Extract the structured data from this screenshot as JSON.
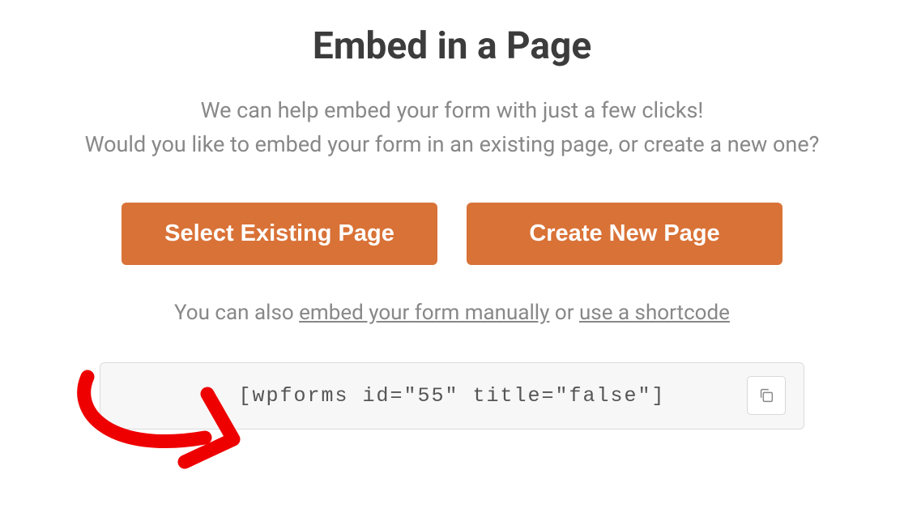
{
  "title": "Embed in a Page",
  "subtitle_line1": "We can help embed your form with just a few clicks!",
  "subtitle_line2": "Would you like to embed your form in an existing page, or create a new one?",
  "buttons": {
    "existing": "Select Existing Page",
    "new": "Create New Page"
  },
  "alt": {
    "prefix": "You can also ",
    "link1": "embed your form manually",
    "middle": " or ",
    "link2": "use a shortcode"
  },
  "shortcode": "[wpforms id=\"55\" title=\"false\"]"
}
